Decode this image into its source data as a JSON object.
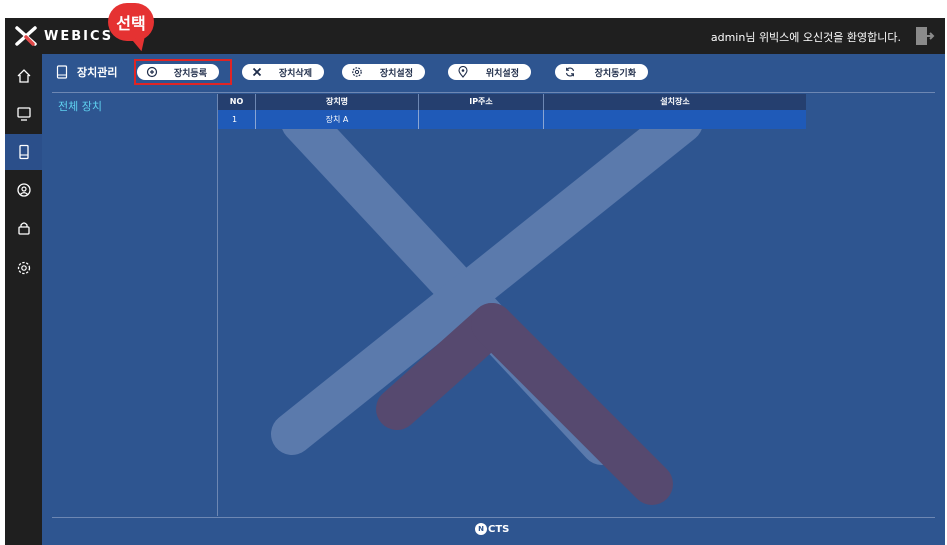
{
  "header": {
    "logo_text": "WEBICS",
    "welcome": "admin님 위빅스에 오신것을 환영합니다.",
    "icons": [
      "webics-x-logo-icon",
      "logout-door-icon"
    ]
  },
  "callout": {
    "label": "선택",
    "color": "#e53232"
  },
  "sidebar": {
    "icons": [
      "home-icon",
      "monitor-icon",
      "device-icon",
      "user-circle-icon",
      "lock-icon",
      "gear-icon"
    ],
    "active": "device-icon"
  },
  "page": {
    "title": "장치관리",
    "side_title": "전체 장치"
  },
  "toolbar": {
    "buttons": [
      {
        "label": "장치등록",
        "icon": "plus-circle-icon"
      },
      {
        "label": "장치삭제",
        "icon": "x-icon"
      },
      {
        "label": "장치설정",
        "icon": "gear-icon"
      },
      {
        "label": "위치설정",
        "icon": "location-pin-icon"
      },
      {
        "label": "장치동기화",
        "icon": "sync-icon"
      }
    ]
  },
  "table": {
    "columns": [
      "NO",
      "장치명",
      "IP주소",
      "설치장소"
    ],
    "rows": [
      [
        "1",
        "장치 A",
        "",
        ""
      ]
    ]
  },
  "footer": {
    "brand": "CTS",
    "brand_mark": "N"
  },
  "colors": {
    "main_bg": "#2e5590",
    "topbar_bg": "#1f1f1f",
    "row_selected": "#1f5ab8",
    "accent_cyan": "#5fd1f0"
  }
}
